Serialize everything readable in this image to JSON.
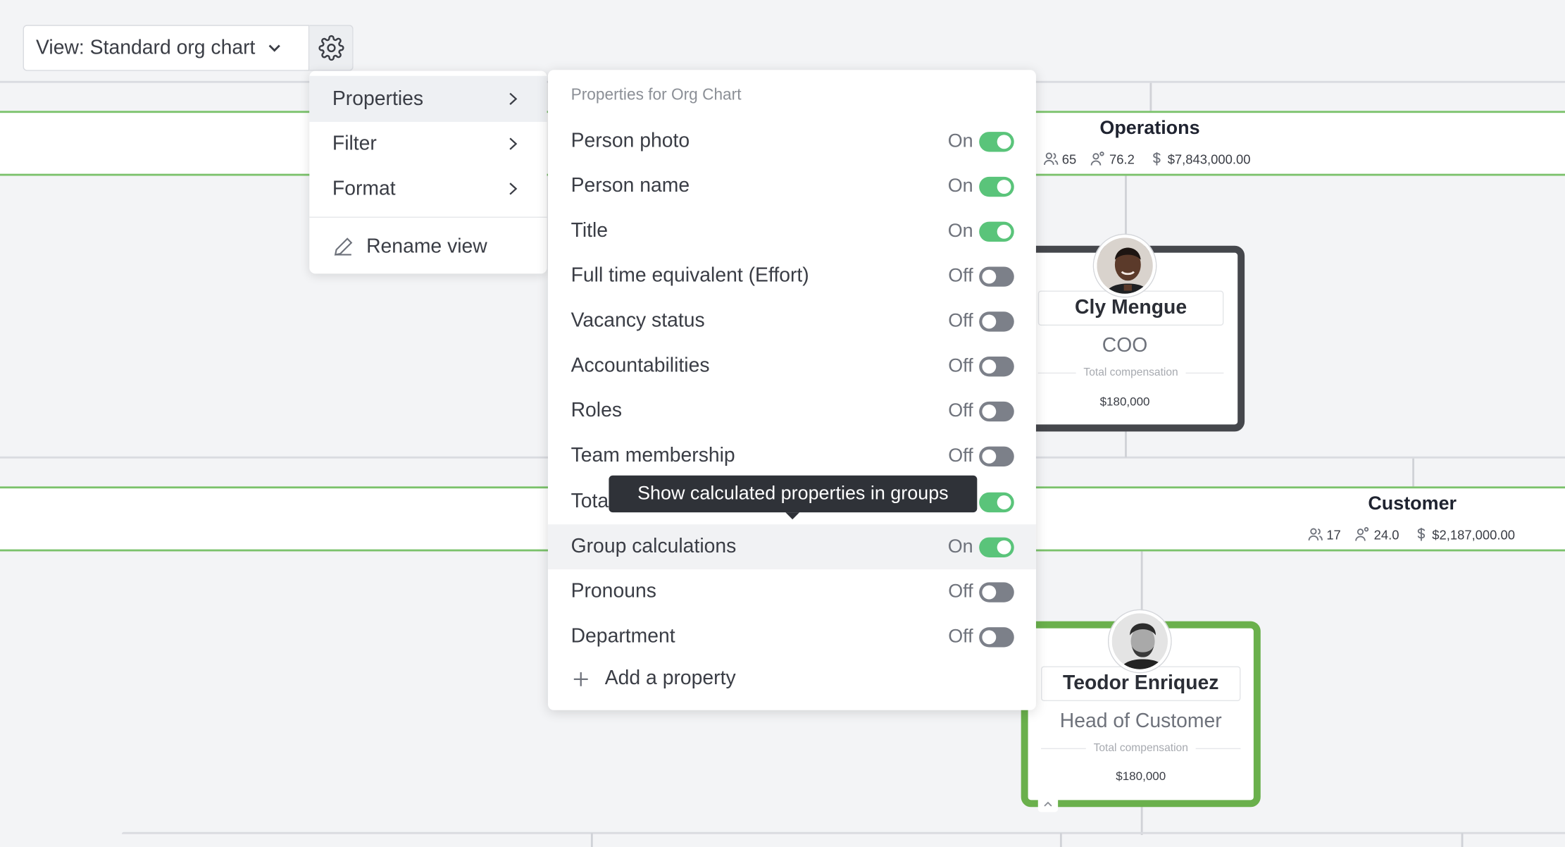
{
  "view_selector": {
    "label": "View: Standard org chart"
  },
  "menu": {
    "items": [
      {
        "label": "Properties"
      },
      {
        "label": "Filter"
      },
      {
        "label": "Format"
      }
    ],
    "rename_label": "Rename view"
  },
  "submenu": {
    "heading": "Properties for Org Chart",
    "properties": [
      {
        "label": "Person photo",
        "state": "On",
        "on": true
      },
      {
        "label": "Person name",
        "state": "On",
        "on": true
      },
      {
        "label": "Title",
        "state": "On",
        "on": true
      },
      {
        "label": "Full time equivalent (Effort)",
        "state": "Off",
        "on": false
      },
      {
        "label": "Vacancy status",
        "state": "Off",
        "on": false
      },
      {
        "label": "Accountabilities",
        "state": "Off",
        "on": false
      },
      {
        "label": "Roles",
        "state": "Off",
        "on": false
      },
      {
        "label": "Team membership",
        "state": "Off",
        "on": false
      },
      {
        "label": "Tota",
        "state": "",
        "on": true
      },
      {
        "label": "Group calculations",
        "state": "On",
        "on": true
      },
      {
        "label": "Pronouns",
        "state": "Off",
        "on": false
      },
      {
        "label": "Department",
        "state": "Off",
        "on": false
      }
    ],
    "add_label": "Add a property"
  },
  "tooltip": {
    "text": "Show calculated properties in groups"
  },
  "groups": [
    {
      "title": "Operations",
      "people": "65",
      "fte": "76.2",
      "cost": "$7,843,000.00"
    },
    {
      "title": "Customer",
      "people": "17",
      "fte": "24.0",
      "cost": "$2,187,000.00"
    }
  ],
  "people": [
    {
      "name": "Cly Mengue",
      "title": "COO",
      "comp_label": "Total compensation",
      "comp_value": "$180,000"
    },
    {
      "name": "Teodor Enriquez",
      "title": "Head of Customer",
      "comp_label": "Total compensation",
      "comp_value": "$180,000"
    }
  ],
  "colors": {
    "accent_green": "#5ac47a",
    "group_border": "#7bc26b",
    "selected_card_border": "#6ab04c",
    "card_dark_border": "#45474c"
  }
}
